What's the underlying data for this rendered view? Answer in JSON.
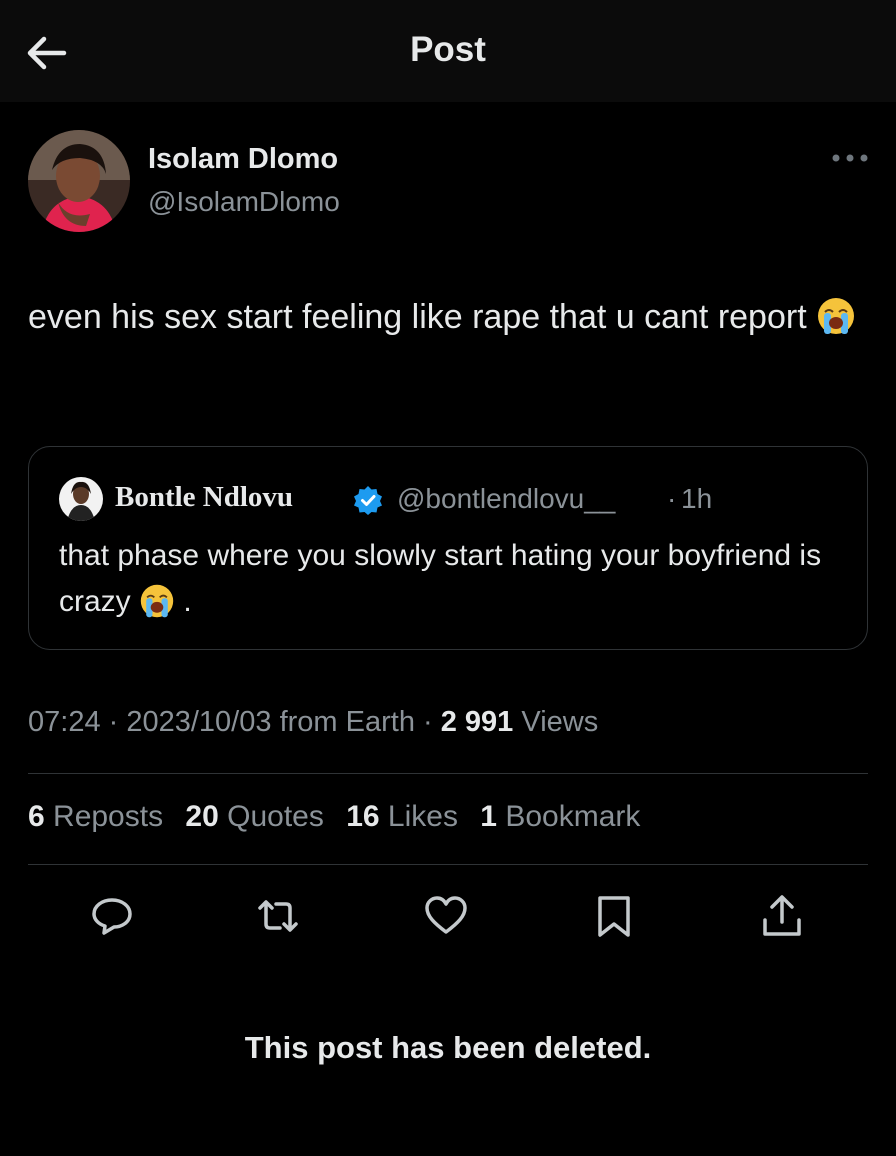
{
  "header": {
    "title": "Post",
    "back_icon": "arrow-left-icon"
  },
  "author": {
    "name": "Isolam Dlomo",
    "handle": "@IsolamDlomo"
  },
  "post": {
    "text": "even his sex start feeling like rape that u cant report",
    "emoji": "loudly-crying-face"
  },
  "quote": {
    "name": "Bontle Ndlovu",
    "verified": true,
    "handle": "@bontlendlovu__",
    "separator": "·",
    "time": "1h",
    "text": "that phase where you slowly start hating your boyfriend is crazy",
    "emoji": "loudly-crying-face",
    "trailing": "."
  },
  "meta": {
    "time": "07:24",
    "sep1": " · ",
    "date": "2023/10/03",
    "source": " from Earth",
    "sep2": " · ",
    "views_count": "2 991",
    "views_label": " Views"
  },
  "stats": [
    {
      "count": "6",
      "label": " Reposts"
    },
    {
      "count": "20",
      "label": " Quotes"
    },
    {
      "count": "16",
      "label": " Likes"
    },
    {
      "count": "1",
      "label": " Bookmark"
    }
  ],
  "actions": [
    "reply-icon",
    "repost-icon",
    "like-icon",
    "bookmark-icon",
    "share-icon"
  ],
  "notice": "This post has been deleted.",
  "colors": {
    "background": "#000000",
    "text": "#e7e9ea",
    "muted": "#8b9298",
    "verified": "#1d9bf0",
    "border": "#2f3336"
  }
}
